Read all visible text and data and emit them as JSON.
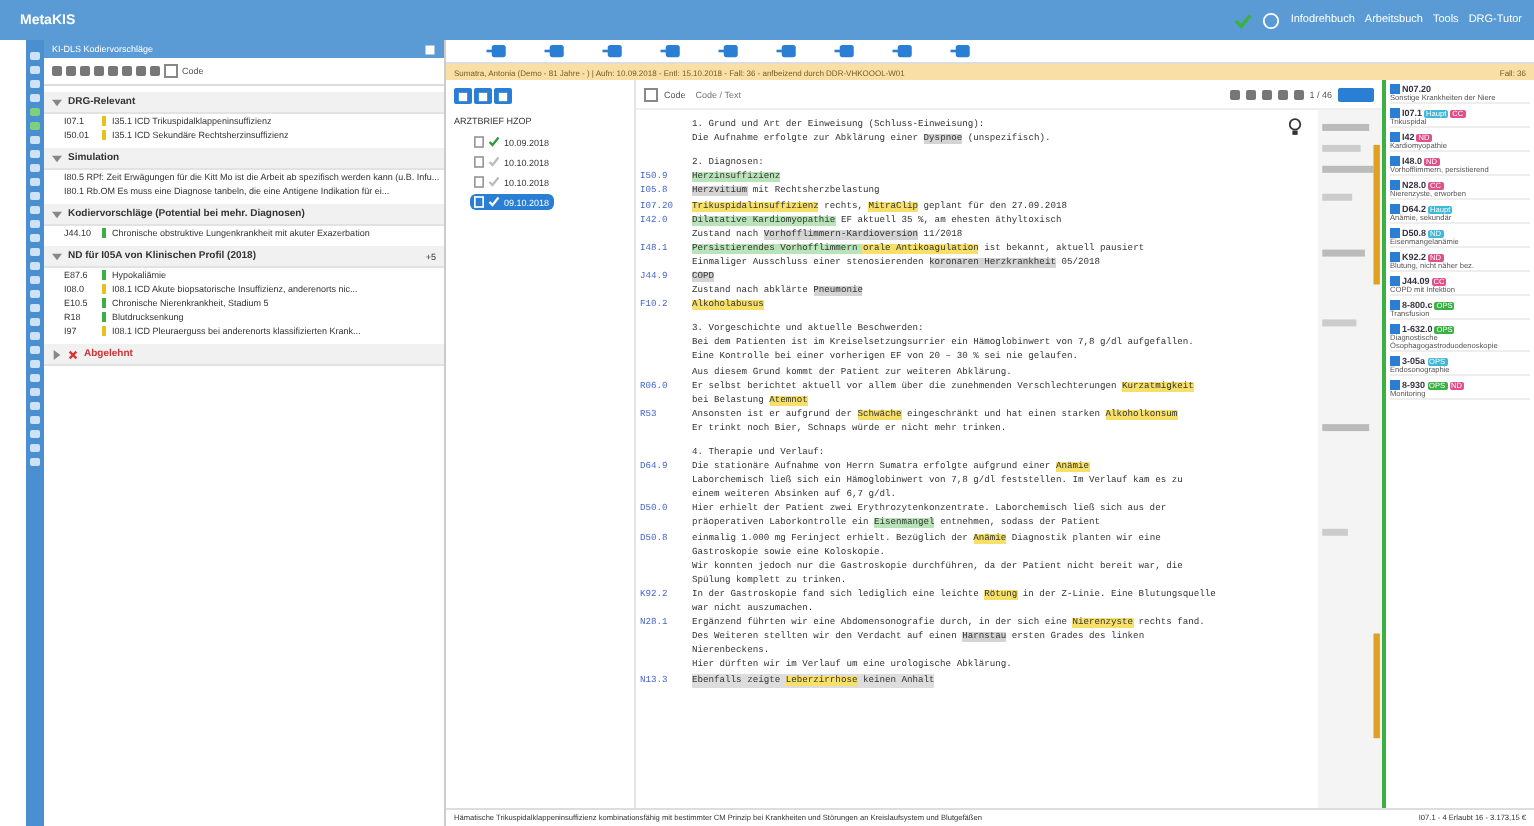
{
  "window": {
    "title": "MetaKIS",
    "menu": [
      "Infodrehbuch",
      "Arbeitsbuch",
      "Tools",
      "DRG-Tutor"
    ]
  },
  "left_panel": {
    "title": "KI-DLS Kodiervorschläge",
    "toolbar_label": "Code",
    "toolbar_checked": false,
    "groups": [
      {
        "title": "DRG-Relevant",
        "expanded": true,
        "items": [
          {
            "code": "I07.1",
            "color": "#e8c020",
            "text": "I35.1 ICD Trikuspidalklappeninsuffizienz"
          },
          {
            "code": "I50.01",
            "color": "#e8c020",
            "text": "I35.1 ICD Sekundäre Rechtsherzinsuffizienz"
          }
        ]
      },
      {
        "title": "Simulation",
        "expanded": true,
        "items": [
          {
            "text": "I80.5 RPf: Zeit Erwägungen für die Kitt Mo ist die Arbeit ab spezifisch werden kann (u.B. Infu..."
          },
          {
            "text": "I80.1 Rb.OM Es muss eine Diagnose tanbeln, die eine Antigene Indikation für ei..."
          }
        ]
      },
      {
        "title": "Kodiervorschläge (Potential bei mehr. Diagnosen)",
        "expanded": true,
        "items": [
          {
            "code": "J44.10",
            "color": "#3cb043",
            "text": "Chronische obstruktive Lungenkrankheit mit akuter Exazerbation"
          }
        ]
      },
      {
        "title": "ND für I05A von Klinischen Profil (2018)",
        "expanded": true,
        "badge": "+5",
        "items": [
          {
            "code": "E87.6",
            "color": "#3cb043",
            "text": "Hypokaliämie"
          },
          {
            "code": "I08.0",
            "color": "#e8c020",
            "text": "I08.1 ICD Akute biopsatorische Insuffizienz, anderenorts nic..."
          },
          {
            "code": "E10.5",
            "color": "#3cb043",
            "text": "Chronische Nierenkrankheit, Stadium 5"
          },
          {
            "code": "R18",
            "color": "#3cb043",
            "text": "Blutdrucksenkung"
          },
          {
            "code": "I97",
            "color": "#e8c020",
            "text": "I08.1 ICD Pleuraerguss bei anderenorts klassifizierten Krank..."
          }
        ]
      },
      {
        "title": "Abgelehnt",
        "expanded": false,
        "kind": "rejected"
      }
    ]
  },
  "patient_bar": "Sumatra, Antonia (Demo - 81 Jahre - ) | Aufn: 10.09.2018 - Entl: 15.10.2018 - Fall: 36 - anfbeizend durch DDR-VHKOOOL-W01",
  "patient_bar_right": "Fall: 36",
  "tree": {
    "root": "ARZTBRIEF HZOP",
    "items": [
      {
        "date": "10.09.2018",
        "checked": true,
        "selected": false
      },
      {
        "date": "10.10.2018",
        "checked": false,
        "selected": false
      },
      {
        "date": "10.10.2018",
        "checked": false,
        "selected": false
      },
      {
        "date": "09.10.2018",
        "checked": true,
        "selected": true
      }
    ]
  },
  "editor": {
    "code_toggle": "Code",
    "code_checked": false,
    "search_placeholder": "Code / Text",
    "page": "1 / 46",
    "lines": [
      {
        "kind": "heading",
        "parts": [
          {
            "t": "1. Grund und Art der Einweisung (Schluss-Einweisung):"
          }
        ]
      },
      {
        "kind": "text",
        "parts": [
          {
            "t": "Die Aufnahme erfolgte zur Abklärung einer "
          },
          {
            "t": "Dyspnoe",
            "color": "#d4d4d4"
          },
          {
            "t": " (unspezifisch)."
          }
        ]
      },
      {
        "kind": "blank"
      },
      {
        "kind": "heading",
        "parts": [
          {
            "t": "2. Diagnosen:"
          }
        ]
      },
      {
        "kind": "text",
        "code": "I50.9",
        "parts": [
          {
            "t": "Herzinsuffizienz",
            "color": "#b9e4b9"
          }
        ]
      },
      {
        "kind": "text",
        "code": "I05.8",
        "parts": [
          {
            "t": "Herzvitium",
            "color": "#d4d4d4"
          },
          {
            "t": " mit Rechtsherzbelastung"
          }
        ]
      },
      {
        "kind": "text",
        "code": "I07.20",
        "parts": [
          {
            "t": "Trikuspidalinsuffizienz",
            "color": "#f7e06a"
          },
          {
            "t": " rechts, "
          },
          {
            "t": "MitraClip",
            "color": "#f7e06a"
          },
          {
            "t": " geplant für den 27.09.2018"
          }
        ]
      },
      {
        "kind": "text",
        "code": "I42.0",
        "parts": [
          {
            "t": "Dilatative Kardiomyopathie",
            "color": "#b9e4b9"
          },
          {
            "t": " EF aktuell 35 %, am ehesten äthyltoxisch"
          }
        ]
      },
      {
        "kind": "text",
        "parts": [
          {
            "t": "Zustand nach "
          },
          {
            "t": "Vorhofflimmern-Kardioversion",
            "color": "#d4d4d4"
          },
          {
            "t": " 11/2018"
          }
        ]
      },
      {
        "kind": "text",
        "code": "I48.1",
        "parts": [
          {
            "t": "Persistierendes Vorhofflimmern ",
            "color": "#b9e4b9"
          },
          {
            "t": "orale Antikoagulation",
            "color": "#f7e06a"
          },
          {
            "t": " ist bekannt, aktuell pausiert"
          }
        ]
      },
      {
        "kind": "text",
        "parts": [
          {
            "t": "Einmaliger Ausschluss einer stenosierenden "
          },
          {
            "t": "koronaren Herzkrankheit",
            "color": "#d4d4d4"
          },
          {
            "t": " 05/2018"
          }
        ]
      },
      {
        "kind": "text",
        "code": "J44.9",
        "parts": [
          {
            "t": "COPD",
            "color": "#d4d4d4"
          }
        ]
      },
      {
        "kind": "text",
        "parts": [
          {
            "t": "Zustand nach abklärte "
          },
          {
            "t": "Pneumonie",
            "color": "#d4d4d4"
          }
        ]
      },
      {
        "kind": "text",
        "code": "F10.2",
        "parts": [
          {
            "t": "Alkoholabusus",
            "color": "#f7e06a"
          }
        ]
      },
      {
        "kind": "blank"
      },
      {
        "kind": "heading",
        "parts": [
          {
            "t": "3. Vorgeschichte und aktuelle Beschwerden:"
          }
        ]
      },
      {
        "kind": "text",
        "parts": [
          {
            "t": "Bei dem Patienten ist im Kreiselsetzungsurrier ein Hämoglobinwert von 7,8 g/dl aufgefallen."
          }
        ]
      },
      {
        "kind": "text",
        "parts": [
          {
            "t": "Eine Kontrolle bei einer vorherigen EF von 20 – 30 % sei nie gelaufen."
          }
        ]
      },
      {
        "kind": "text",
        "parts": [
          {
            "t": "Aus diesem Grund kommt der Patient zur weiteren Abklärung."
          }
        ]
      },
      {
        "kind": "text",
        "code": "R06.0",
        "parts": [
          {
            "t": "Er selbst berichtet aktuell vor allem über die zunehmenden Verschlechterungen "
          },
          {
            "t": "Kurzatmigkeit",
            "color": "#f7e06a"
          }
        ]
      },
      {
        "kind": "text",
        "parts": [
          {
            "t": "bei Belastung "
          },
          {
            "t": "Atemnot",
            "color": "#f7e06a"
          }
        ]
      },
      {
        "kind": "text",
        "code": "R53",
        "parts": [
          {
            "t": "Ansonsten ist er aufgrund der "
          },
          {
            "t": "Schwäche",
            "color": "#f7e06a"
          },
          {
            "t": " eingeschränkt und hat einen starken "
          },
          {
            "t": "Alkoholkonsum",
            "color": "#f7e06a"
          }
        ]
      },
      {
        "kind": "text",
        "parts": [
          {
            "t": "Er trinkt noch Bier, Schnaps würde er nicht mehr trinken."
          }
        ]
      },
      {
        "kind": "blank"
      },
      {
        "kind": "heading",
        "parts": [
          {
            "t": "4. Therapie und Verlauf:"
          }
        ]
      },
      {
        "kind": "text",
        "code": "D64.9",
        "parts": [
          {
            "t": "Die stationäre Aufnahme von Herrn Sumatra erfolgte aufgrund einer "
          },
          {
            "t": "Anämie",
            "color": "#f7e06a"
          }
        ]
      },
      {
        "kind": "text",
        "parts": [
          {
            "t": "Laborchemisch ließ sich ein Hämoglobinwert von 7,8 g/dl feststellen. Im Verlauf kam es zu"
          }
        ]
      },
      {
        "kind": "text",
        "parts": [
          {
            "t": "einem weiteren Absinken auf 6,7 g/dl."
          }
        ]
      },
      {
        "kind": "text",
        "code": "D50.0",
        "parts": [
          {
            "t": "Hier erhielt der Patient zwei Erythrozytenkonzentrate. Laborchemisch ließ sich aus der"
          }
        ]
      },
      {
        "kind": "text",
        "parts": [
          {
            "t": "präoperativen Laborkontrolle ein "
          },
          {
            "t": "Eisenmangel",
            "color": "#b9e4b9"
          },
          {
            "t": " entnehmen, sodass der Patient"
          }
        ]
      },
      {
        "kind": "text",
        "code": "D50.8",
        "parts": [
          {
            "t": "einmalig 1.000 mg Ferinject erhielt. Bezüglich der "
          },
          {
            "t": "Anämie",
            "color": "#f7e06a"
          },
          {
            "t": " Diagnostik planten wir eine"
          }
        ]
      },
      {
        "kind": "text",
        "parts": [
          {
            "t": "Gastroskopie sowie eine Koloskopie."
          }
        ]
      },
      {
        "kind": "text",
        "parts": [
          {
            "t": "Wir konnten jedoch nur die Gastroskopie durchführen, da der Patient nicht bereit war, die"
          }
        ]
      },
      {
        "kind": "text",
        "parts": [
          {
            "t": "Spülung komplett zu trinken."
          }
        ]
      },
      {
        "kind": "text",
        "code": "K92.2",
        "parts": [
          {
            "t": "In der Gastroskopie fand sich lediglich eine leichte "
          },
          {
            "t": "Rötung",
            "color": "#f7e06a"
          },
          {
            "t": " in der Z-Linie. Eine Blutungsquelle"
          }
        ]
      },
      {
        "kind": "text",
        "parts": [
          {
            "t": "war nicht auszumachen."
          }
        ]
      },
      {
        "kind": "text",
        "code": "N28.1",
        "parts": [
          {
            "t": "Ergänzend führten wir eine Abdomensonografie durch, in der sich eine "
          },
          {
            "t": "Nierenzyste",
            "color": "#f7e06a"
          },
          {
            "t": " rechts fand."
          }
        ]
      },
      {
        "kind": "text",
        "parts": [
          {
            "t": "Des Weiteren stellten wir den Verdacht auf einen "
          },
          {
            "t": "Harnstau",
            "color": "#d4d4d4"
          },
          {
            "t": " ersten Grades des linken"
          }
        ]
      },
      {
        "kind": "text",
        "parts": [
          {
            "t": "Nierenbeckens."
          }
        ]
      },
      {
        "kind": "text",
        "parts": [
          {
            "t": "Hier dürften wir im Verlauf um eine urologische Abklärung."
          }
        ]
      },
      {
        "kind": "struck",
        "code": "N13.3",
        "parts": [
          {
            "t": "Ebenfalls zeigte "
          },
          {
            "t": "Leberzirrhose",
            "color": "#f7e06a"
          },
          {
            "t": " keinen Anhalt"
          }
        ]
      }
    ]
  },
  "codes": [
    {
      "code": "N07.20",
      "checked": true,
      "text": "Sonstige Krankheiten der Niere"
    },
    {
      "code": "I07.1",
      "checked": true,
      "tags": [
        {
          "label": "Haupt",
          "color": "#40b8d8"
        },
        {
          "label": "CC",
          "color": "#e0508a"
        }
      ],
      "text": "Trikuspidal"
    },
    {
      "code": "I42",
      "checked": true,
      "tags": [
        {
          "label": "ND",
          "color": "#e0508a"
        }
      ],
      "text": "Kardiomyopathie"
    },
    {
      "code": "I48.0",
      "checked": true,
      "tags": [
        {
          "label": "ND",
          "color": "#e0508a"
        }
      ],
      "text": "Vorhofflimmern, persistierend"
    },
    {
      "code": "N28.0",
      "checked": true,
      "tags": [
        {
          "label": "CC",
          "color": "#e0508a"
        }
      ],
      "text": "Nierenzyste, erworben"
    },
    {
      "code": "D64.2",
      "checked": true,
      "tags": [
        {
          "label": "Haupt",
          "color": "#40b8d8"
        }
      ],
      "text": "Anämie, sekundär"
    },
    {
      "code": "D50.8",
      "checked": true,
      "tags": [
        {
          "label": "ND",
          "color": "#40b8d8"
        }
      ],
      "text": "Eisenmangelanämie"
    },
    {
      "code": "K92.2",
      "checked": true,
      "tags": [
        {
          "label": "ND",
          "color": "#e0508a"
        }
      ],
      "text": "Blutung, nicht näher bez."
    },
    {
      "code": "J44.09",
      "checked": true,
      "tags": [
        {
          "label": "CC",
          "color": "#e0508a"
        }
      ],
      "text": "COPD mit Infektion"
    },
    {
      "code": "8-800.c",
      "checked": true,
      "tags": [
        {
          "label": "OPS",
          "color": "#3cb043"
        }
      ],
      "text": "Transfusion"
    },
    {
      "code": "1-632.0",
      "checked": true,
      "tags": [
        {
          "label": "OPS",
          "color": "#3cb043"
        }
      ],
      "text": "Diagnostische Ösophagogastroduodenoskopie"
    },
    {
      "code": "3-05a",
      "checked": true,
      "tags": [
        {
          "label": "OPS",
          "color": "#40b8d8"
        }
      ],
      "text": "Endosonographie"
    },
    {
      "code": "8-930",
      "checked": true,
      "tags": [
        {
          "label": "OPS",
          "color": "#3cb043"
        },
        {
          "label": "ND",
          "color": "#e0508a"
        }
      ],
      "text": "Monitoring"
    }
  ],
  "status_bar": {
    "text": "Hämatische Trikuspidalklappeninsuffizienz kombinationsfähig mit bestimmter CM Prinzip bei Krankheiten und Störungen an Kreislaufsystem und Blutgefäßen",
    "right": "I07.1 - 4 Erlaubt 16 - 3.173,15 €"
  }
}
